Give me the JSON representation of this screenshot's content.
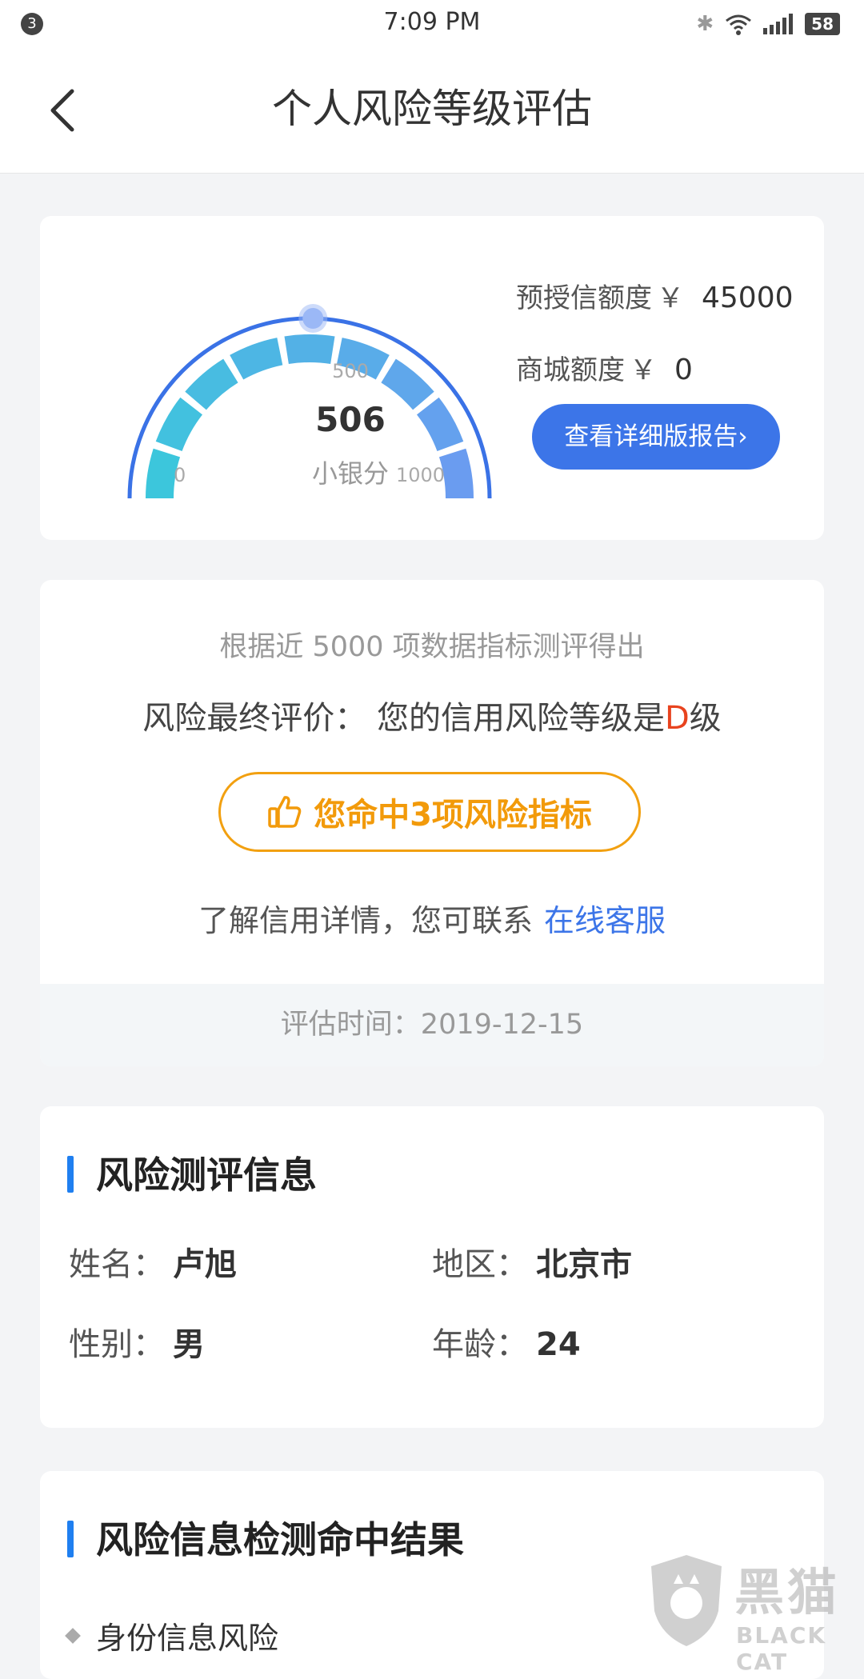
{
  "status_bar": {
    "notification_count": "3",
    "time": "7:09 PM",
    "battery": "58",
    "icons": [
      "bluetooth-icon",
      "wifi-icon",
      "signal-icon",
      "battery-icon"
    ]
  },
  "nav": {
    "title": "个人风险等级评估",
    "back_icon": "chevron-left-icon"
  },
  "score_card": {
    "score": "506",
    "score_label": "小银分",
    "tick_min": "0",
    "tick_mid": "500",
    "tick_max": "1000",
    "score_fraction": 0.506,
    "pre_credit_label": "预授信额度",
    "pre_credit_currency": "￥",
    "pre_credit_value": "45000",
    "mall_credit_label": "商城额度",
    "mall_credit_currency": "￥",
    "mall_credit_value": "0",
    "report_button": "查看详细版报告",
    "report_button_arrow": "›"
  },
  "evaluation": {
    "subtitle": "根据近 5000 项数据指标测评得出",
    "final_label": "风险最终评价：",
    "final_text": "您的信用风险等级是",
    "grade": "D",
    "grade_suffix": "级",
    "hit_button": "您命中3项风险指标",
    "hit_icon": "thumbs-up-icon",
    "contact_text": "了解信用详情，您可联系",
    "contact_link": "在线客服",
    "eval_time_label": "评估时间：",
    "eval_time_value": "2019-12-15"
  },
  "info": {
    "title": "风险测评信息",
    "name_label": "姓名：",
    "name_value": "卢旭",
    "region_label": "地区：",
    "region_value": "北京市",
    "gender_label": "性别：",
    "gender_value": "男",
    "age_label": "年龄：",
    "age_value": "24"
  },
  "result": {
    "title": "风险信息检测命中结果",
    "items": [
      "身份信息风险"
    ]
  },
  "watermark": {
    "cn": "黑猫",
    "en": "BLACK CAT"
  },
  "colors": {
    "accent_blue": "#3c75e8",
    "warning_orange": "#f29a0a",
    "grade_red": "#e8431e",
    "gauge_start": "#3cc6dc",
    "gauge_end": "#6a9cf0"
  }
}
